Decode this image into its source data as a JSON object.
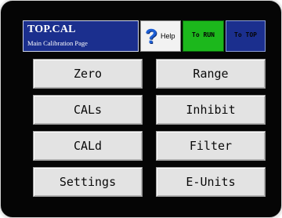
{
  "header": {
    "title": "TOP.CAL",
    "subtitle": "Main Calibration Page",
    "help_label": "Help",
    "run_label": "To RUN",
    "top_label": "To TOP"
  },
  "menu": {
    "zero": "Zero",
    "range": "Range",
    "cals": "CALs",
    "inhibit": "Inhibit",
    "cald": "CALd",
    "filter": "Filter",
    "settings": "Settings",
    "e_units": "E-Units"
  },
  "icons": {
    "help": "question-mark-icon"
  },
  "colors": {
    "title_background": "#1b2f8e",
    "run_button": "#1cb81c",
    "top_button": "#1b2f8e",
    "menu_button": "#e3e3e3",
    "help_icon": "#1d5fd6",
    "screen_background": "#050505"
  }
}
